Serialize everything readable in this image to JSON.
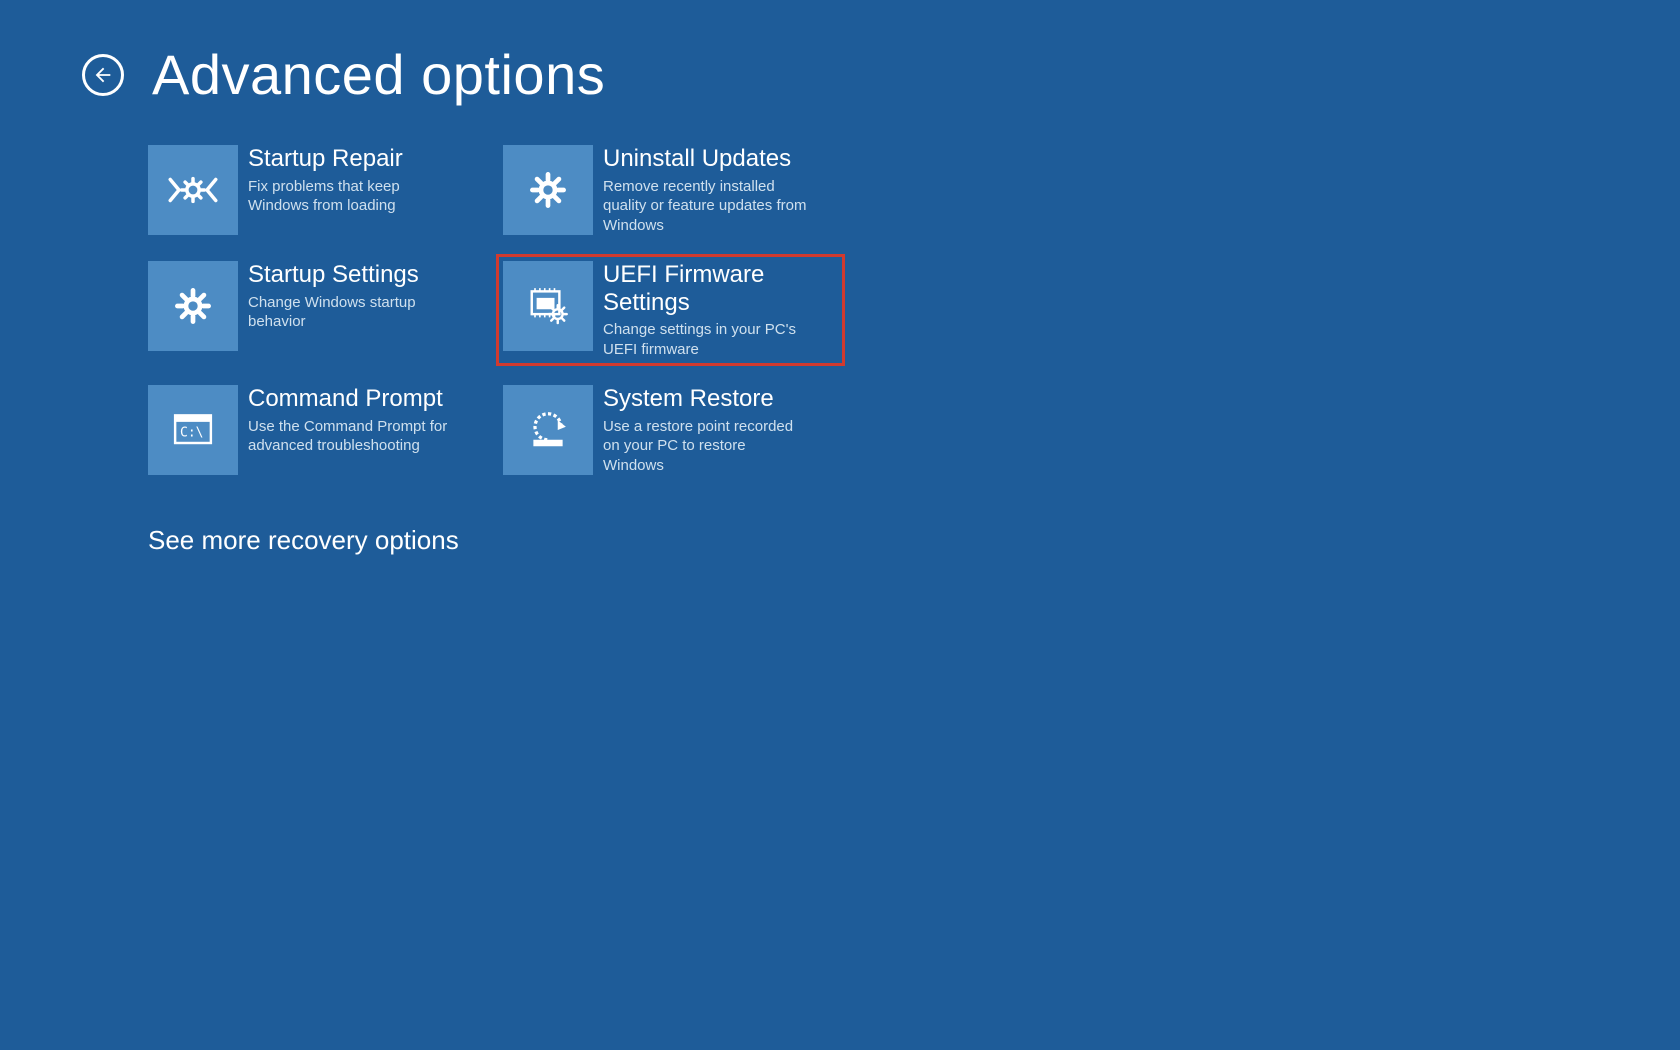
{
  "header": {
    "title": "Advanced options"
  },
  "tiles": [
    {
      "title": "Startup Repair",
      "desc": "Fix problems that keep Windows from loading",
      "icon": "startup-repair"
    },
    {
      "title": "Uninstall Updates",
      "desc": "Remove recently installed quality or feature updates from Windows",
      "icon": "gear"
    },
    {
      "title": "Startup Settings",
      "desc": "Change Windows startup behavior",
      "icon": "gear"
    },
    {
      "title": "UEFI Firmware Settings",
      "desc": "Change settings in your PC's UEFI firmware",
      "icon": "firmware",
      "highlighted": true
    },
    {
      "title": "Command Prompt",
      "desc": "Use the Command Prompt for advanced troubleshooting",
      "icon": "cmd"
    },
    {
      "title": "System Restore",
      "desc": "Use a restore point recorded on your PC to restore Windows",
      "icon": "restore"
    }
  ],
  "more_link": "See more recovery options"
}
